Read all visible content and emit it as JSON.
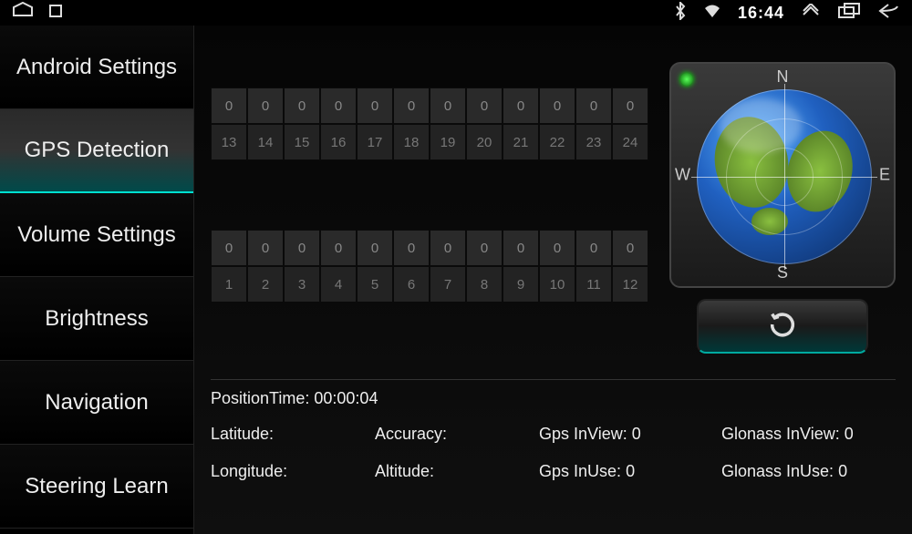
{
  "status": {
    "time": "16:44"
  },
  "sidebar": {
    "items": [
      {
        "label": "Android Settings"
      },
      {
        "label": "GPS Detection"
      },
      {
        "label": "Volume Settings"
      },
      {
        "label": "Brightness"
      },
      {
        "label": "Navigation"
      },
      {
        "label": "Steering Learn"
      }
    ],
    "active_index": 1
  },
  "signal_top": {
    "values": [
      "0",
      "0",
      "0",
      "0",
      "0",
      "0",
      "0",
      "0",
      "0",
      "0",
      "0",
      "0"
    ],
    "labels": [
      "13",
      "14",
      "15",
      "16",
      "17",
      "18",
      "19",
      "20",
      "21",
      "22",
      "23",
      "24"
    ]
  },
  "signal_bottom": {
    "values": [
      "0",
      "0",
      "0",
      "0",
      "0",
      "0",
      "0",
      "0",
      "0",
      "0",
      "0",
      "0"
    ],
    "labels": [
      "1",
      "2",
      "3",
      "4",
      "5",
      "6",
      "7",
      "8",
      "9",
      "10",
      "11",
      "12"
    ]
  },
  "compass": {
    "n": "N",
    "s": "S",
    "e": "E",
    "w": "W"
  },
  "info": {
    "position_time_label": "PositionTime:",
    "position_time_value": "00:00:04",
    "latitude_label": "Latitude:",
    "latitude_value": "",
    "longitude_label": "Longitude:",
    "longitude_value": "",
    "accuracy_label": "Accuracy:",
    "accuracy_value": "",
    "altitude_label": "Altitude:",
    "altitude_value": "",
    "gps_inview_label": "Gps InView:",
    "gps_inview_value": "0",
    "gps_inuse_label": "Gps InUse:",
    "gps_inuse_value": "0",
    "glonass_inview_label": "Glonass InView:",
    "glonass_inview_value": "0",
    "glonass_inuse_label": "Glonass InUse:",
    "glonass_inuse_value": "0"
  }
}
